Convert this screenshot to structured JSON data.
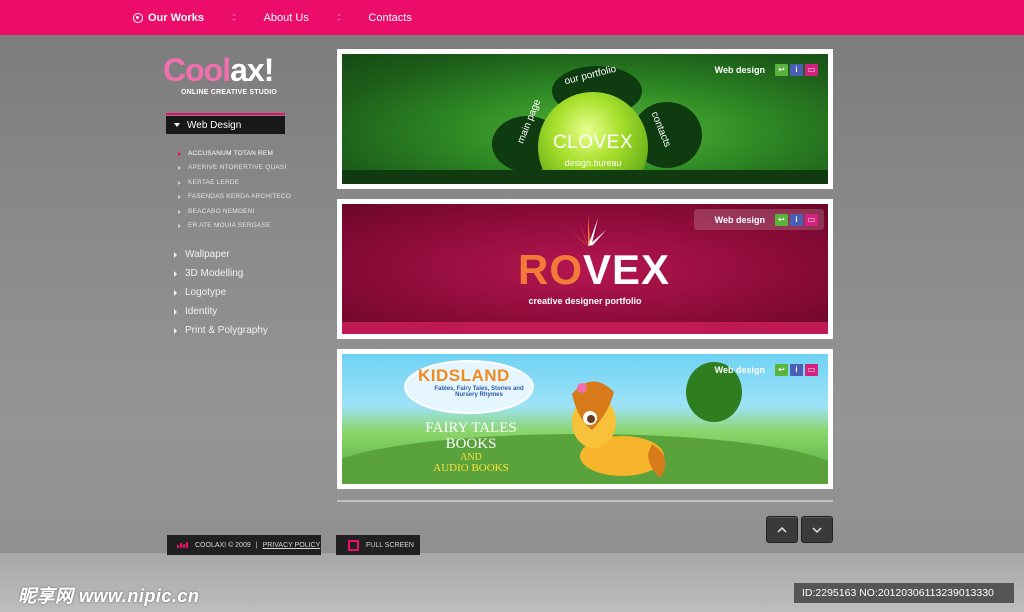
{
  "nav": {
    "items": [
      {
        "label": "Our Works",
        "active": true
      },
      {
        "label": "About Us"
      },
      {
        "label": "Contacts"
      }
    ],
    "separator": "::"
  },
  "logo": {
    "part1": "Cool",
    "part2": "ax!",
    "tagline": "ONLINE CREATIVE STUDIO"
  },
  "sidebar": {
    "active_category": "Web Design",
    "sub_items": [
      "ACCUSANUM TOTAN REM",
      "APERIVE NTORERTIVE QUASI",
      "KERTAE LERDE",
      "FASENDAS KERDA ARCHITECO",
      "BEACABO NEMOENI",
      "ER ATE MOUIA SERGASE"
    ],
    "categories": [
      "Wallpaper",
      "3D Modelling",
      "Logotype",
      "Identity",
      "Print & Polygraphy"
    ]
  },
  "cards": [
    {
      "tag": "Web design",
      "title": "CLOVEX",
      "subtitle": "design.bureau",
      "petals": [
        "our portfolio",
        "main page",
        "contacts"
      ]
    },
    {
      "tag": "Web design",
      "title_a": "RO",
      "title_b": "VEX",
      "subtitle": "creative designer portfolio"
    },
    {
      "tag": "Web design",
      "brand": "KIDSLAND",
      "brand_sub": "Fables, Fairy Tales, Stories and Nursery Rhymes",
      "lines": [
        "FAIRY TALES",
        "BOOKS",
        "AND",
        "AUDIO BOOKS"
      ]
    }
  ],
  "icons": {
    "share": "share-icon",
    "info": "info-icon",
    "comment": "comment-icon"
  },
  "footer": {
    "copyright": "COOLAX! © 2009",
    "divider": "|",
    "privacy": "PRIVACY POLICY",
    "fullscreen": "FULL SCREEN"
  },
  "watermark": {
    "left": "昵享网 www.nipic.cn",
    "right": "ID:2295163 NO:20120306113239013330"
  },
  "colors": {
    "accent": "#ec0c6a",
    "logo_pink": "#f06fae"
  }
}
